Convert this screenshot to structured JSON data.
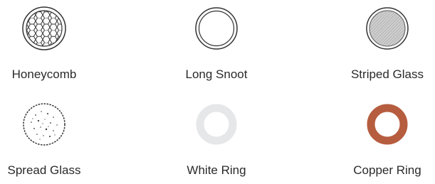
{
  "accessories": [
    {
      "label": "Honeycomb",
      "icon": "honeycomb-grid-icon"
    },
    {
      "label": "Long Snoot",
      "icon": "long-snoot-icon"
    },
    {
      "label": "Striped Glass",
      "icon": "striped-glass-icon"
    },
    {
      "label": "Spread Glass",
      "icon": "spread-glass-icon"
    },
    {
      "label": "White Ring",
      "icon": "white-ring-icon",
      "color": "#e6e7e9"
    },
    {
      "label": "Copper Ring",
      "icon": "copper-ring-icon",
      "color": "#b65d3f"
    }
  ]
}
